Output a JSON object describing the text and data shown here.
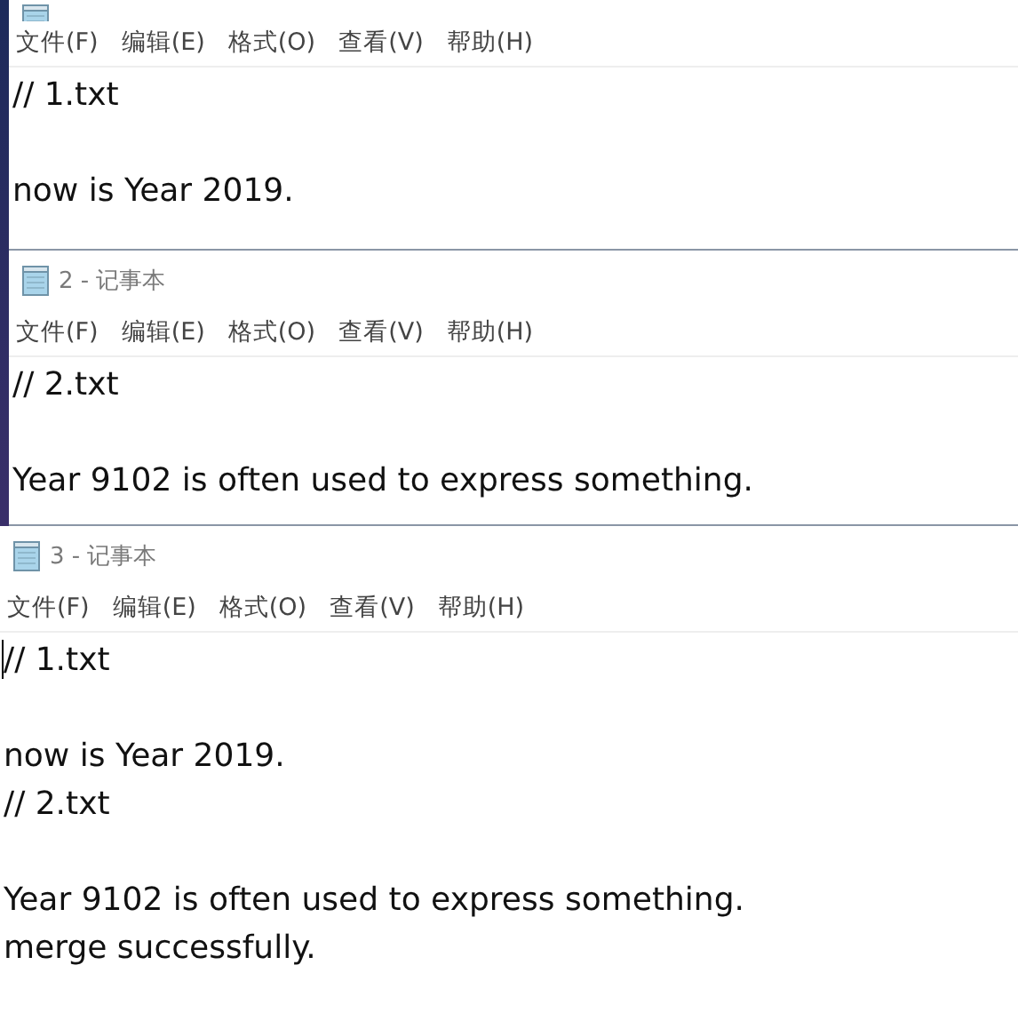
{
  "windows": [
    {
      "title_cut": true,
      "menu": [
        "文件(F)",
        "编辑(E)",
        "格式(O)",
        "查看(V)",
        "帮助(H)"
      ],
      "content": "// 1.txt\n\nnow is Year 2019.",
      "caret": false
    },
    {
      "title": "2 - 记事本",
      "menu": [
        "文件(F)",
        "编辑(E)",
        "格式(O)",
        "查看(V)",
        "帮助(H)"
      ],
      "content": "// 2.txt\n\nYear 9102 is often used to express something.",
      "caret": false
    },
    {
      "title": "3 - 记事本",
      "menu": [
        "文件(F)",
        "编辑(E)",
        "格式(O)",
        "查看(V)",
        "帮助(H)"
      ],
      "content": "// 1.txt\n\nnow is Year 2019.\n// 2.txt\n\nYear 9102 is often used to express something.\nmerge successfully.",
      "caret": true
    }
  ]
}
